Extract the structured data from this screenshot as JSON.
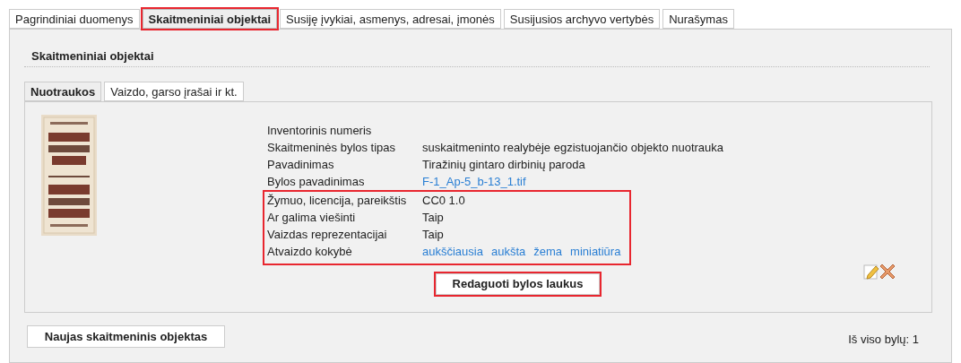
{
  "tabs": [
    {
      "label": "Pagrindiniai duomenys",
      "selected": false,
      "highlighted": false
    },
    {
      "label": "Skaitmeniniai objektai",
      "selected": true,
      "highlighted": true
    },
    {
      "label": "Susiję įvykiai, asmenys, adresai, įmonės",
      "selected": false,
      "highlighted": false
    },
    {
      "label": "Susijusios archyvo vertybės",
      "selected": false,
      "highlighted": false
    },
    {
      "label": "Nurašymas",
      "selected": false,
      "highlighted": false
    }
  ],
  "section_title": "Skaitmeniniai objektai",
  "subtabs": [
    {
      "label": "Nuotraukos",
      "selected": true
    },
    {
      "label": "Vaizdo, garso įrašai ir kt.",
      "selected": false
    }
  ],
  "field_groups": [
    {
      "highlighted": false,
      "fields": [
        {
          "label": "Inventorinis numeris"
        },
        {
          "label": "Skaitmeninės bylos tipas",
          "values": [
            {
              "text": "suskaitmeninto realybėje egzistuojančio objekto nuotrauka",
              "link": false
            }
          ]
        },
        {
          "label": "Pavadinimas",
          "values": [
            {
              "text": "Tiražinių gintaro dirbinių paroda",
              "link": false
            }
          ]
        },
        {
          "label": "Bylos pavadinimas",
          "values": [
            {
              "text": "F-1_Ap-5_b-13_1.tif",
              "link": true
            }
          ]
        }
      ]
    },
    {
      "highlighted": true,
      "fields": [
        {
          "label": "Žymuo, licencija, pareikštis",
          "values": [
            {
              "text": "CC0 1.0",
              "link": false
            }
          ]
        },
        {
          "label": "Ar galima viešinti",
          "values": [
            {
              "text": "Taip",
              "link": false
            }
          ]
        },
        {
          "label": "Vaizdas reprezentacijai",
          "values": [
            {
              "text": "Taip",
              "link": false
            }
          ]
        },
        {
          "label": "Atvaizdo kokybė",
          "values": [
            {
              "text": "aukščiausia",
              "link": true
            },
            {
              "text": "aukšta",
              "link": true
            },
            {
              "text": "žema",
              "link": true
            },
            {
              "text": "miniatiūra",
              "link": true
            }
          ]
        }
      ]
    }
  ],
  "edit_button": {
    "label": "Redaguoti bylos laukus",
    "highlighted": true
  },
  "new_button": {
    "label": "Naujas skaitmeninis objektas"
  },
  "total": "Iš viso bylų: 1"
}
